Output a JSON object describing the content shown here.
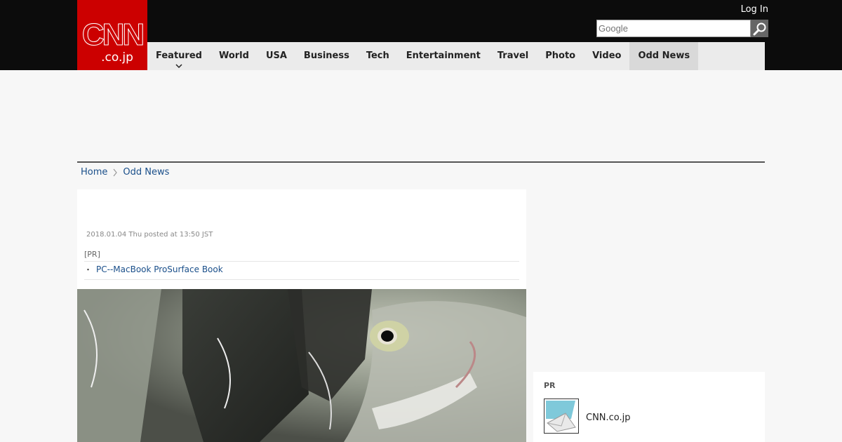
{
  "header": {
    "logo_main": "CNN",
    "logo_sub": ".co.jp",
    "login_label": "Log In",
    "search_placeholder": "Google"
  },
  "nav": {
    "items": [
      {
        "label": "Featured"
      },
      {
        "label": "World"
      },
      {
        "label": "USA"
      },
      {
        "label": "Business"
      },
      {
        "label": "Tech"
      },
      {
        "label": "Entertainment"
      },
      {
        "label": "Travel"
      },
      {
        "label": "Photo"
      },
      {
        "label": "Video"
      },
      {
        "label": "Odd News"
      }
    ],
    "active": "Odd News"
  },
  "breadcrumb": {
    "home": "Home",
    "current": "Odd News"
  },
  "article": {
    "posted": "2018.01.04 Thu posted at 13:50 JST",
    "pr_tag": "[PR]",
    "pr_bullet": "・",
    "pr_link": "PC--MacBook ProSurface Book"
  },
  "sidebar_pr": {
    "title": "PR",
    "name": "CNN.co.jp"
  },
  "colors": {
    "brand_red": "#cc0000",
    "topbar": "#0c0c0c",
    "nav_bg": "#ebebeb",
    "link": "#1a4f8a"
  },
  "icons": [
    "search-icon",
    "chevron-down-icon",
    "chevron-right-icon",
    "mail-icon"
  ]
}
